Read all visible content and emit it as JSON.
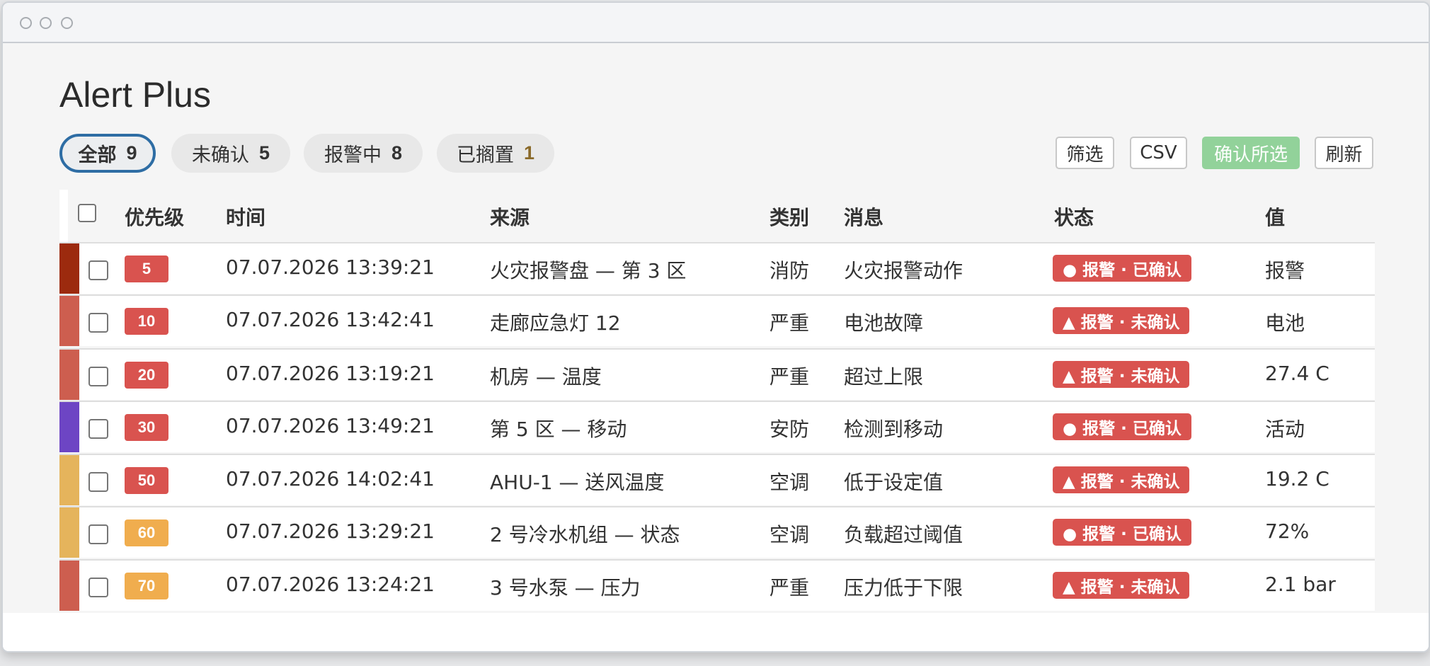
{
  "app": {
    "title": "Alert Plus"
  },
  "filters": [
    {
      "label": "全部",
      "count": "9"
    },
    {
      "label": "未确认",
      "count": "5"
    },
    {
      "label": "报警中",
      "count": "8"
    },
    {
      "label": "已搁置",
      "count": "1"
    }
  ],
  "toolbar": {
    "filter_label": "筛选",
    "csv_label": "CSV",
    "confirm_label": "确认所选",
    "refresh_label": "刷新"
  },
  "table": {
    "headers": {
      "priority": "优先级",
      "time": "时间",
      "source": "来源",
      "category": "类别",
      "message": "消息",
      "status": "状态",
      "value": "值"
    },
    "rows": [
      {
        "priority": "5",
        "time": "07.07.2026 13:39:21",
        "source": "火灾报警盘 — 第 3 区",
        "category": "消防",
        "message": "火灾报警动作",
        "status": "● 报警 · 已确认",
        "value": "报警",
        "bar_color": "#9c2a0e",
        "prio_color": "#d9534f"
      },
      {
        "priority": "10",
        "time": "07.07.2026 13:42:41",
        "source": "走廊应急灯 12",
        "category": "严重",
        "message": "电池故障",
        "status": "▲ 报警 · 未确认",
        "value": "电池",
        "bar_color": "#cd5e4f",
        "prio_color": "#d9534f"
      },
      {
        "priority": "20",
        "time": "07.07.2026 13:19:21",
        "source": "机房 — 温度",
        "category": "严重",
        "message": "超过上限",
        "status": "▲ 报警 · 未确认",
        "value": "27.4 C",
        "bar_color": "#cd5e4f",
        "prio_color": "#d9534f"
      },
      {
        "priority": "30",
        "time": "07.07.2026 13:49:21",
        "source": "第 5 区 — 移动",
        "category": "安防",
        "message": "检测到移动",
        "status": "● 报警 · 已确认",
        "value": "活动",
        "bar_color": "#6d45c4",
        "prio_color": "#d9534f"
      },
      {
        "priority": "50",
        "time": "07.07.2026 14:02:41",
        "source": "AHU-1 — 送风温度",
        "category": "空调",
        "message": "低于设定值",
        "status": "▲ 报警 · 未确认",
        "value": "19.2 C",
        "bar_color": "#e5b45c",
        "prio_color": "#d9534f"
      },
      {
        "priority": "60",
        "time": "07.07.2026 13:29:21",
        "source": "2 号冷水机组 — 状态",
        "category": "空调",
        "message": "负载超过阈值",
        "status": "● 报警 · 已确认",
        "value": "72%",
        "bar_color": "#e5b45c",
        "prio_color": "#f0ad4e"
      },
      {
        "priority": "70",
        "time": "07.07.2026 13:24:21",
        "source": "3 号水泵 — 压力",
        "category": "严重",
        "message": "压力低于下限",
        "status": "▲ 报警 · 未确认",
        "value": "2.1 bar",
        "bar_color": "#cd5e4f",
        "prio_color": "#f0ad4e"
      }
    ]
  }
}
